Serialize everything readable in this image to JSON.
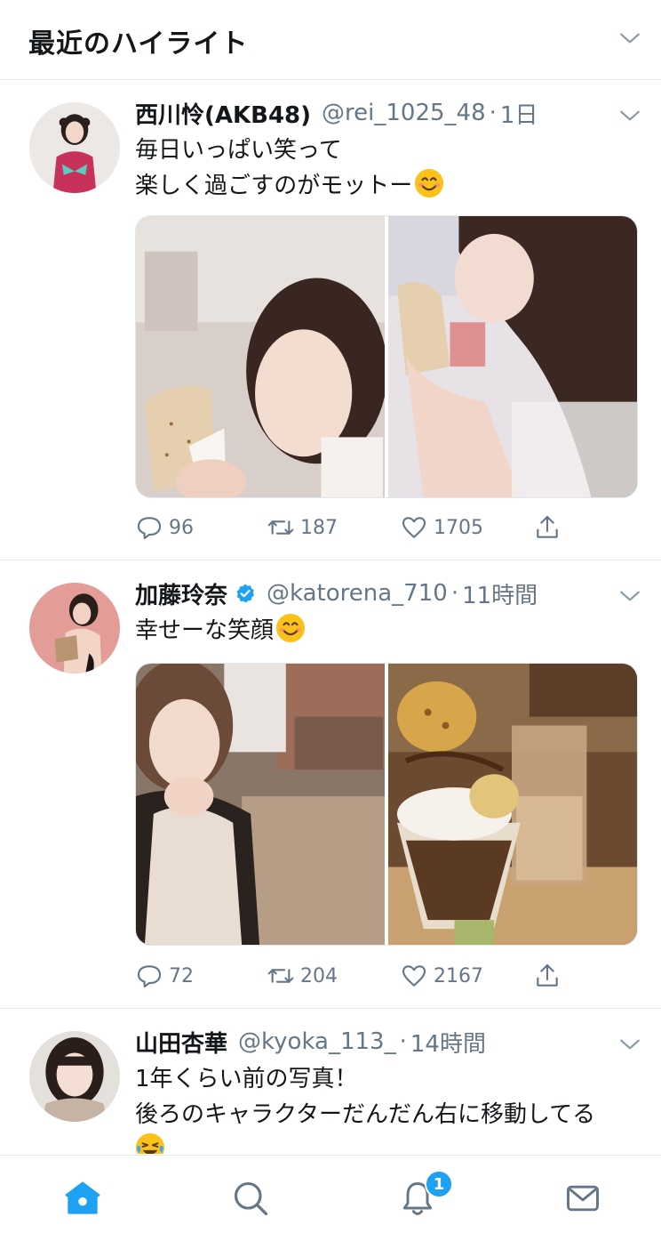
{
  "header": {
    "title": "最近のハイライト",
    "chevron_icon": "chevron-down-icon"
  },
  "colors": {
    "accent": "#1da1f2",
    "muted": "#657786",
    "divider": "#e1e8ed"
  },
  "tweets": [
    {
      "name": "西川怜(AKB48)",
      "verified": false,
      "handle": "@rei_1025_48",
      "separator": "·",
      "time": "1日",
      "text_lines": [
        "毎日いっぱい笑って",
        "楽しく過ごすのがモットー"
      ],
      "emoji": "smiling-face-icon",
      "stats": {
        "replies": "96",
        "retweets": "187",
        "likes": "1705"
      }
    },
    {
      "name": "加藤玲奈",
      "verified": true,
      "handle": "@katorena_710",
      "separator": "·",
      "time": "11時間",
      "text_lines": [
        "幸せーな笑顔"
      ],
      "emoji": "smiling-face-icon",
      "stats": {
        "replies": "72",
        "retweets": "204",
        "likes": "2167"
      }
    },
    {
      "name": "山田杏華",
      "verified": false,
      "handle": "@kyoka_113_",
      "separator": "·",
      "time": "14時間",
      "text_lines": [
        "1年くらい前の写真！",
        "後ろのキャラクターだんだん右に移動してる"
      ],
      "emoji": "laughing-tears-icon"
    }
  ],
  "tabbar": {
    "items": [
      "home-icon",
      "search-icon",
      "notifications-icon",
      "messages-icon"
    ],
    "notification_badge": "1"
  }
}
